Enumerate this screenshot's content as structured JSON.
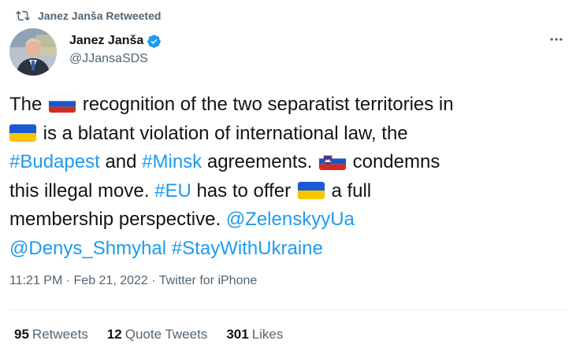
{
  "retweet_banner": {
    "text": "Janez Janša Retweeted"
  },
  "author": {
    "display_name": "Janez Janša",
    "handle": "@JJansaSDS",
    "verified": true
  },
  "tweet": {
    "line1_a": "The",
    "line1_b": "recognition of the two separatist territories in",
    "line2_a": "is a blatant violation of international law, the",
    "line3_tag1": "#Budapest",
    "line3_and": "and",
    "line3_tag2": "#Minsk",
    "line3_b": "agreements.",
    "line3_c": "condemns",
    "line4_a": "this illegal move.",
    "line4_tag": "#EU",
    "line4_b": "has to offer",
    "line4_c": "a full",
    "line5_a": "membership perspective.",
    "line5_mention": "@ZelenskyyUa",
    "line6_mention": "@Denys_Shmyhal",
    "line6_tag": "#StayWithUkraine"
  },
  "flags": {
    "russia": "flag-russia",
    "ukraine": "flag-ukraine",
    "slovenia": "flag-slovenia"
  },
  "meta": {
    "time": "11:21 PM",
    "separator": "·",
    "date": "Feb 21, 2022",
    "source": "Twitter for iPhone"
  },
  "stats": {
    "retweets_count": "95",
    "retweets_label": "Retweets",
    "quotes_count": "12",
    "quotes_label": "Quote Tweets",
    "likes_count": "301",
    "likes_label": "Likes"
  },
  "colors": {
    "link": "#1d9bf0",
    "secondary_text": "#536471",
    "primary_text": "#0f1419",
    "divider": "#eff3f4"
  }
}
